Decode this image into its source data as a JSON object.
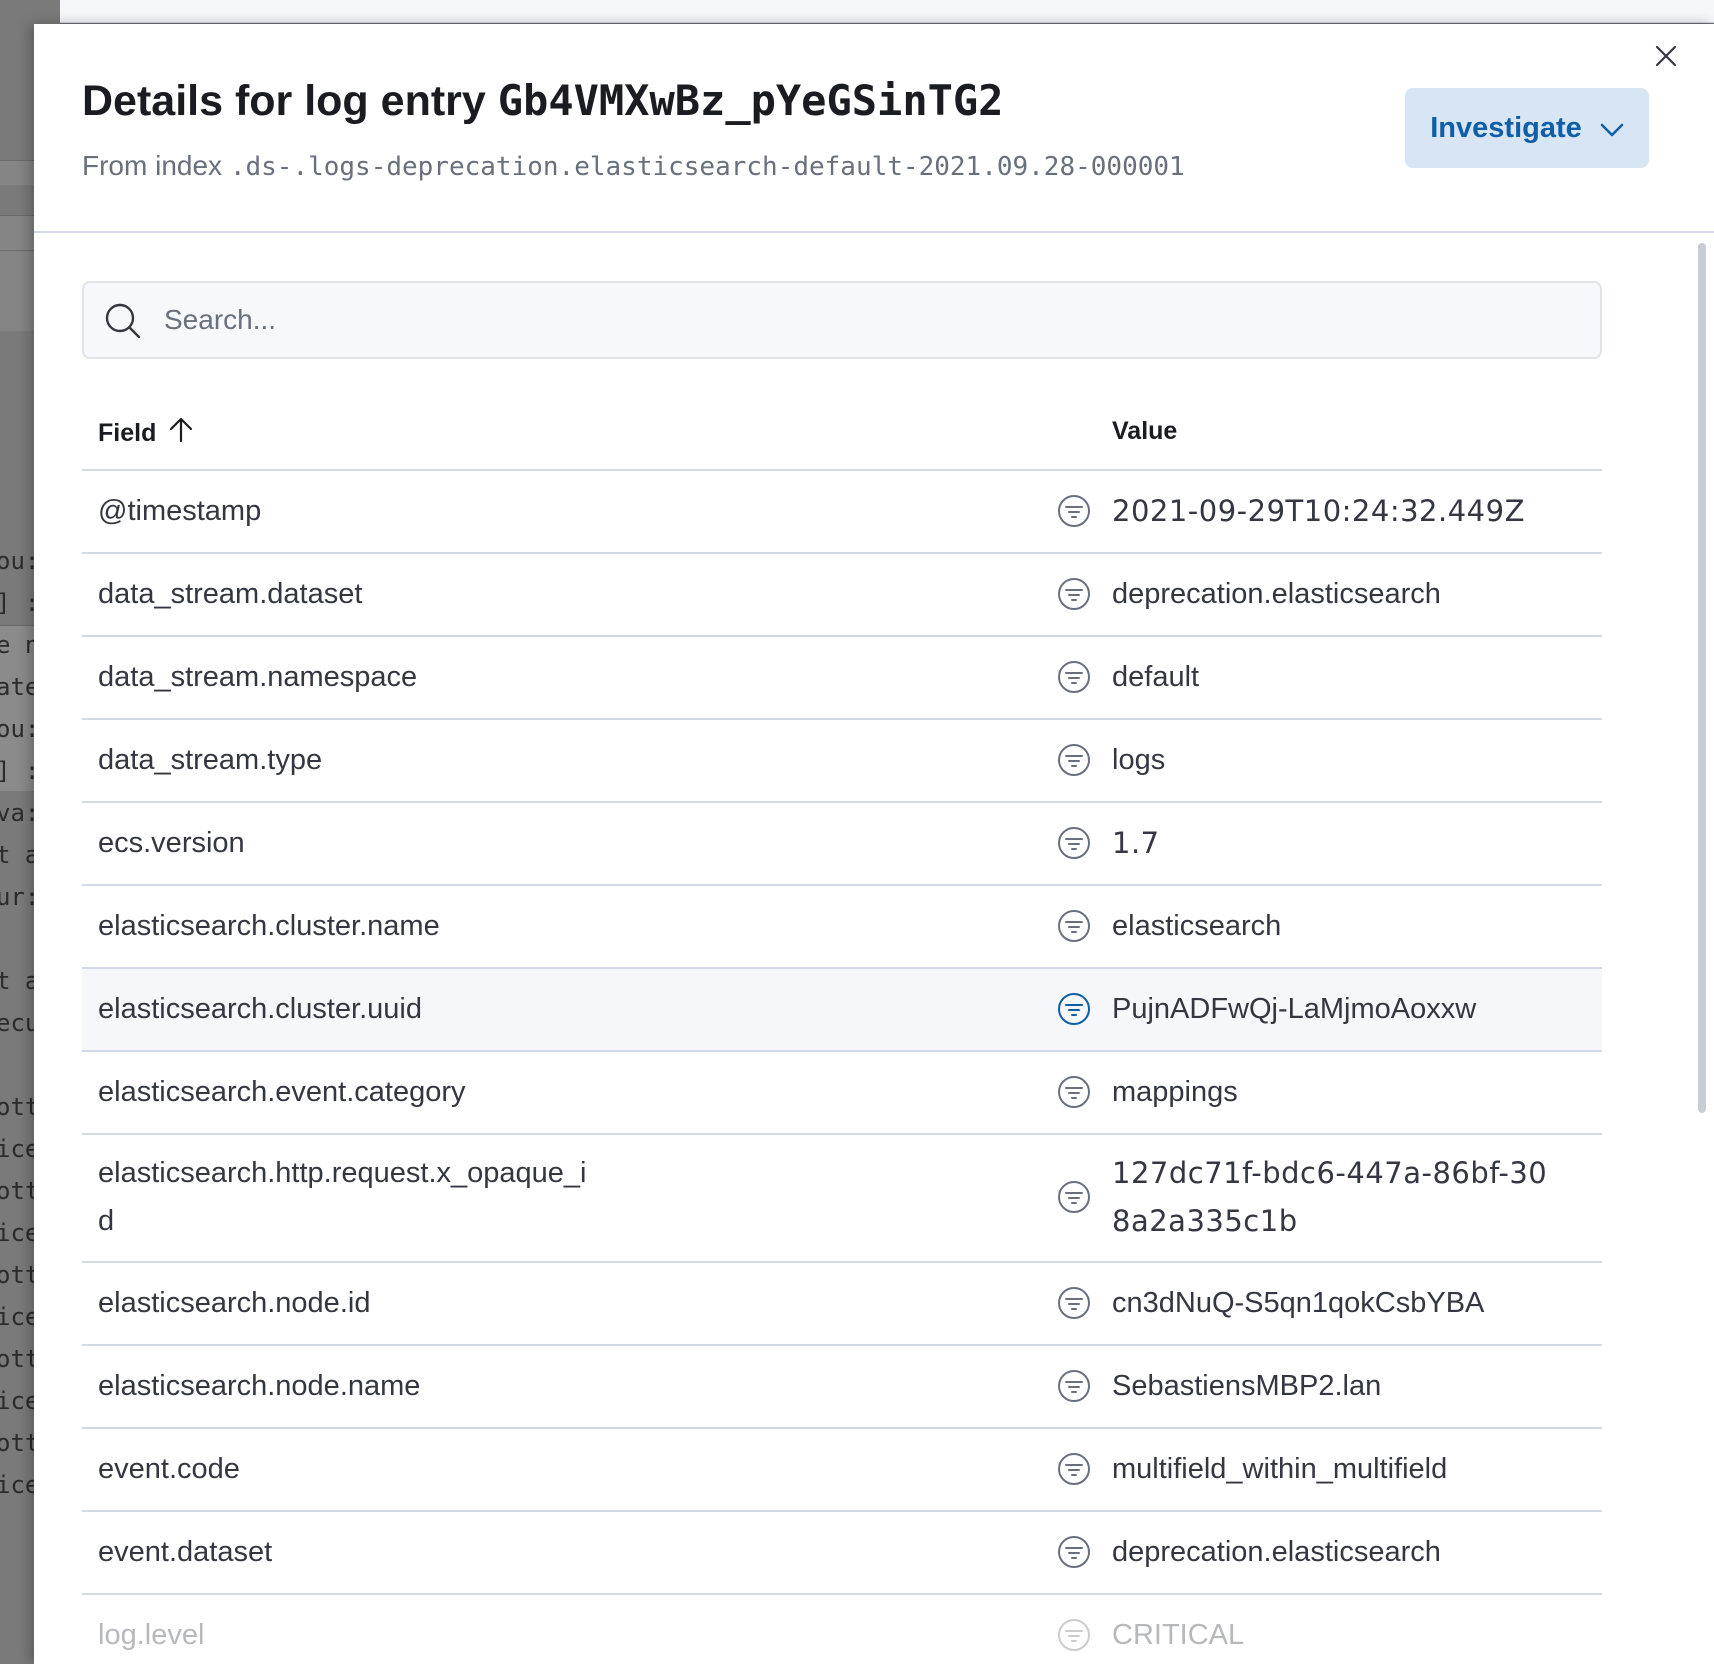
{
  "flyout": {
    "title_prefix": "Details for log entry",
    "entry_id": "Gb4VMXwBz_pYeGSinTG2",
    "subtitle_prefix": "From index",
    "index_name": ".ds-.logs-deprecation.elasticsearch-default-2021.09.28-000001",
    "investigate_label": "Investigate"
  },
  "search": {
    "placeholder": "Search..."
  },
  "table": {
    "field_header": "Field",
    "value_header": "Value",
    "rows": [
      {
        "field": "@timestamp",
        "value": "2021-09-29T10:24:32.449Z"
      },
      {
        "field": "data_stream.dataset",
        "value": "deprecation.elasticsearch"
      },
      {
        "field": "data_stream.namespace",
        "value": "default"
      },
      {
        "field": "data_stream.type",
        "value": "logs"
      },
      {
        "field": "ecs.version",
        "value": "1.7"
      },
      {
        "field": "elasticsearch.cluster.name",
        "value": "elasticsearch"
      },
      {
        "field": "elasticsearch.cluster.uuid",
        "value": "PujnADFwQj-LaMjmoAoxxw"
      },
      {
        "field": "elasticsearch.event.category",
        "value": "mappings"
      },
      {
        "field": "elasticsearch.http.request.x_opaque_id",
        "value": "127dc71f-bdc6-447a-86bf-308a2a335c1b"
      },
      {
        "field": "elasticsearch.node.id",
        "value": "cn3dNuQ-S5qn1qokCsbYBA"
      },
      {
        "field": "elasticsearch.node.name",
        "value": "SebastiensMBP2.lan"
      },
      {
        "field": "event.code",
        "value": "multifield_within_multifield"
      },
      {
        "field": "event.dataset",
        "value": "deprecation.elasticsearch"
      },
      {
        "field": "log.level",
        "value": "CRITICAL"
      }
    ]
  },
  "background": {
    "code_fragments": [
      "ou:",
      "] :",
      "e n",
      "ate",
      "ou:",
      "] :",
      "va:",
      "t a",
      "ur:",
      "",
      "t a",
      "ecu",
      "",
      "ott",
      "ice",
      "ott",
      "ice",
      "ott",
      "ice",
      "ott",
      "ice",
      "ott",
      "ice"
    ]
  },
  "colors": {
    "accent": "#0f5ea8",
    "button_bg": "#d8e5f5",
    "border": "#d3dae6",
    "highlight_row": "#f5f7fa"
  }
}
